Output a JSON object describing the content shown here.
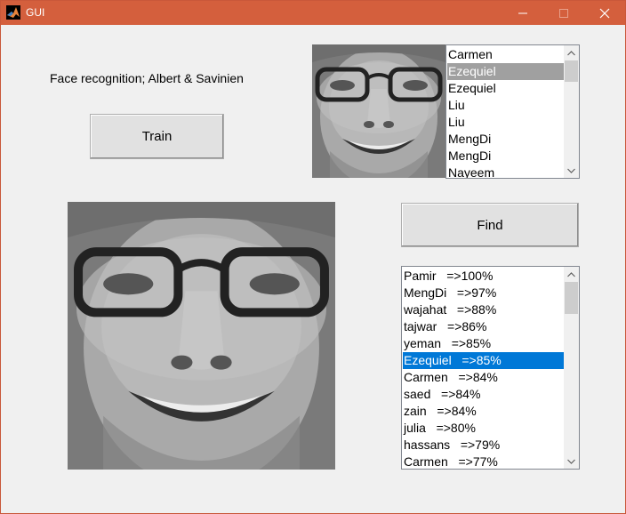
{
  "window": {
    "title": "GUI",
    "title_bar_color": "#d45f3d",
    "app_icon": "matlab-icon",
    "controls": {
      "minimize": "minimize-icon",
      "maximize": "maximize-icon",
      "close": "close-icon"
    }
  },
  "main": {
    "heading": "Face recognition; Albert & Savinien",
    "train_label": "Train",
    "find_label": "Find"
  },
  "names_list": {
    "items": [
      "Carmen",
      "Ezequiel",
      "Ezequiel",
      "Liu",
      "Liu",
      "MengDi",
      "MengDi",
      "Nayeem"
    ],
    "selected_index": 1,
    "selection_color": "#a0a0a0"
  },
  "results_list": {
    "items": [
      "Pamir   =>100%",
      "MengDi   =>97%",
      "wajahat   =>88%",
      "tajwar   =>86%",
      "yeman   =>85%",
      "Ezequiel   =>85%",
      "Carmen   =>84%",
      "saed   =>84%",
      "zain   =>84%",
      "julia   =>80%",
      "hassans   =>79%",
      "Carmen   =>77%"
    ],
    "selected_index": 5,
    "selection_color": "#0078d7"
  },
  "images": {
    "query_face": "grayscale-face-photo",
    "match_face": "grayscale-face-photo"
  }
}
